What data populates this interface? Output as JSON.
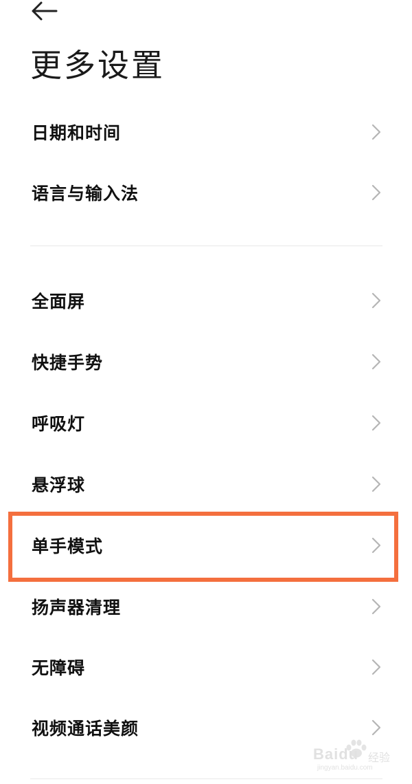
{
  "header": {
    "back_icon": "arrow-left-icon",
    "title": "更多设置"
  },
  "settings": {
    "group1": [
      {
        "label": "日期和时间"
      },
      {
        "label": "语言与输入法"
      }
    ],
    "group2": [
      {
        "label": "全面屏"
      },
      {
        "label": "快捷手势"
      },
      {
        "label": "呼吸灯"
      },
      {
        "label": "悬浮球"
      },
      {
        "label": "单手模式",
        "highlighted": true
      },
      {
        "label": "扬声器清理"
      },
      {
        "label": "无障碍"
      },
      {
        "label": "视频通话美颜"
      }
    ],
    "chevron_icon": "chevron-right-icon"
  },
  "colors": {
    "highlight_border": "#f46f3e",
    "text": "#111111",
    "chevron": "#b5b5b5",
    "divider": "#e8e8e8"
  },
  "watermark": {
    "brand": "Baidu",
    "sub": "经验",
    "url": "jingyan.baidu.com"
  }
}
